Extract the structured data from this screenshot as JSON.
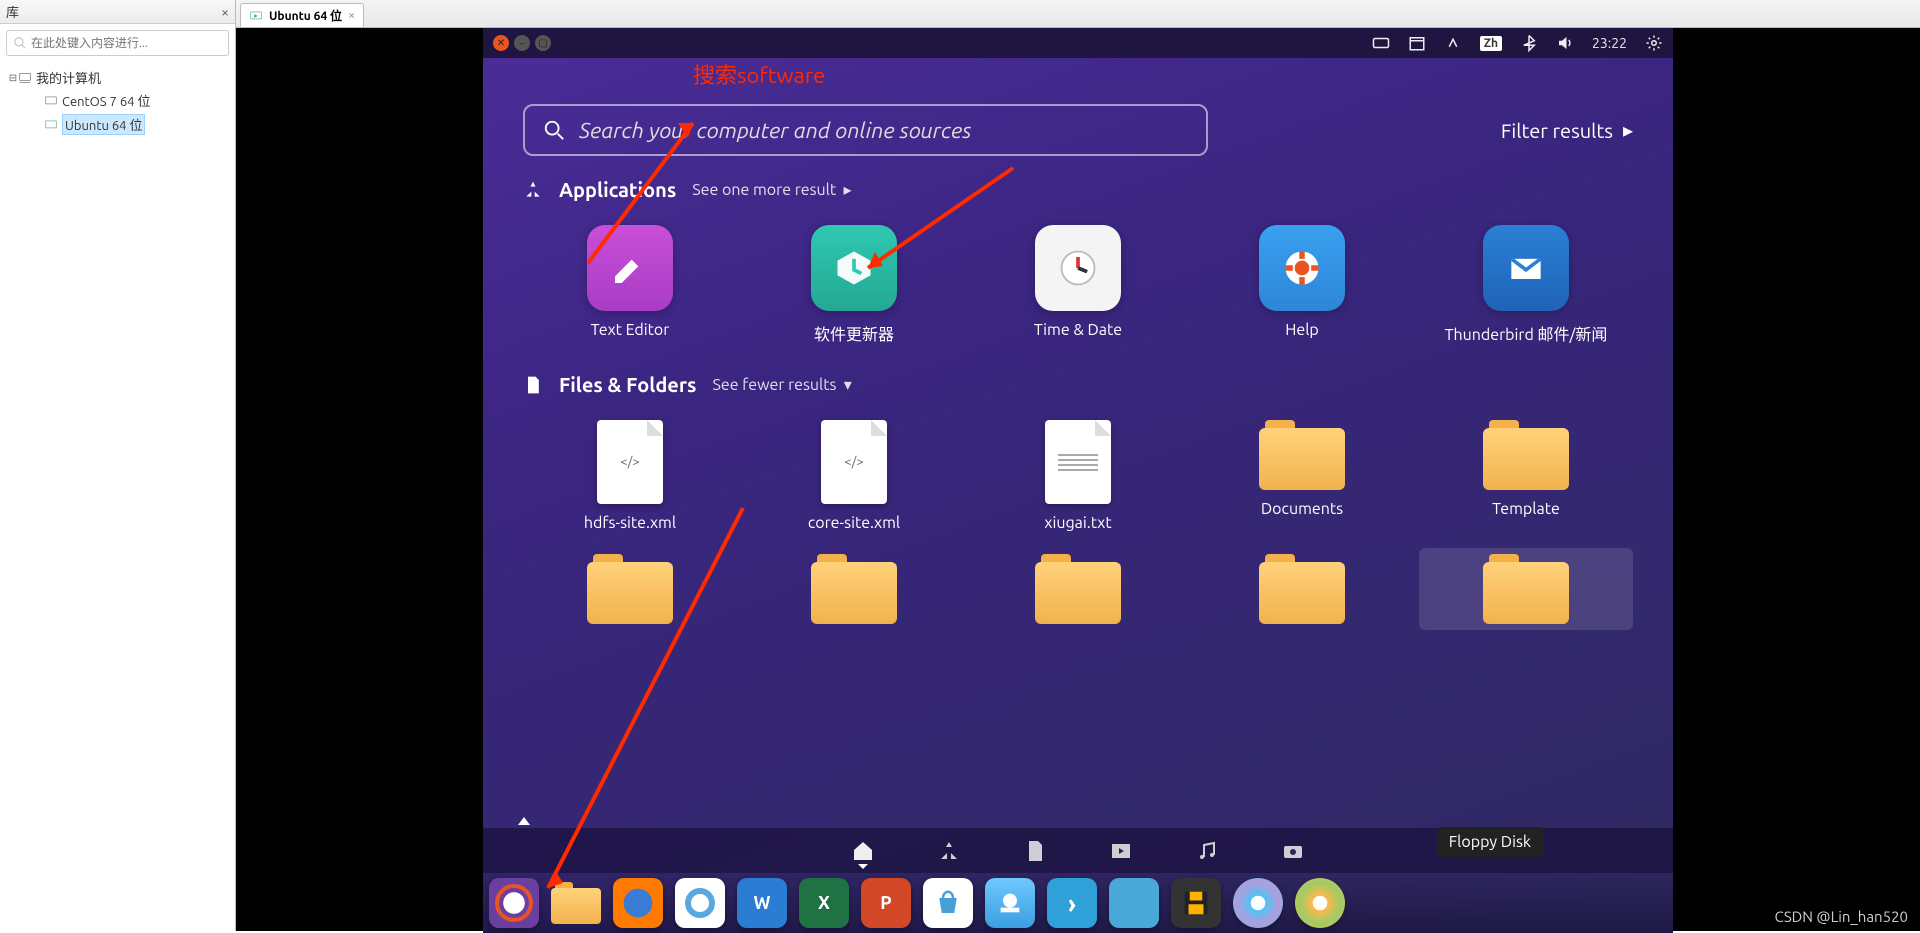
{
  "vmware": {
    "library_title": "库",
    "search_placeholder": "在此处键入内容进行...",
    "root_label": "我的计算机",
    "vm1_label": "CentOS 7 64 位",
    "vm2_label": "Ubuntu 64 位",
    "tab_label": "Ubuntu 64 位"
  },
  "panel": {
    "ime": "Zh",
    "time": "23:22"
  },
  "dash": {
    "annotation": "搜索software",
    "search_placeholder": "Search your computer and online sources",
    "filter_label": "Filter results",
    "apps_header": "Applications",
    "apps_more": "See one more result",
    "files_header": "Files & Folders",
    "files_more": "See fewer results",
    "apps": [
      {
        "label": "Text Editor"
      },
      {
        "label": "软件更新器"
      },
      {
        "label": "Time & Date"
      },
      {
        "label": "Help"
      },
      {
        "label": "Thunderbird 邮件/新闻"
      }
    ],
    "files_row1": [
      {
        "label": "hdfs-site.xml",
        "kind": "code"
      },
      {
        "label": "core-site.xml",
        "kind": "code"
      },
      {
        "label": "xiugai.txt",
        "kind": "text"
      },
      {
        "label": "Documents",
        "kind": "folder"
      },
      {
        "label": "Template",
        "kind": "folder"
      }
    ],
    "tooltip": "Floppy Disk"
  },
  "dock": {
    "items": [
      "ubuntu",
      "files",
      "firefox",
      "chromium",
      "word",
      "excel",
      "powerpoint",
      "software-center",
      "monitor",
      "devtools",
      "apps",
      "amazon",
      "cd",
      "dvd"
    ]
  },
  "watermark": "CSDN @Lin_han520"
}
